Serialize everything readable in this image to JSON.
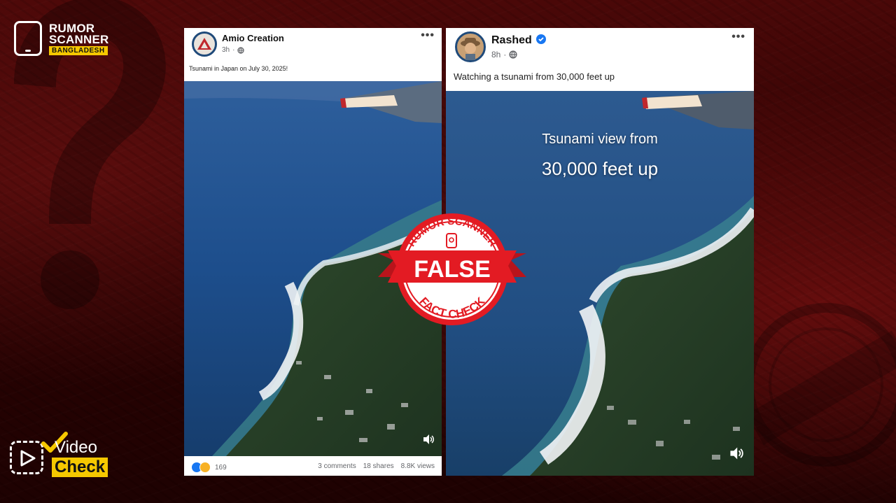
{
  "logo": {
    "line1": "RUMOR",
    "line2": "SCANNER",
    "country": "BANGLADESH",
    "icon": "phone-scan-icon"
  },
  "video_check": {
    "video": "Video",
    "check": "Check",
    "icon": "play-icon"
  },
  "post_left": {
    "author": "Amio Creation",
    "time": "3h",
    "caption": "Tsunami in Japan on July 30, 2025!",
    "reaction_count": "169",
    "comments": "3 comments",
    "shares": "18 shares",
    "views": "8.8K views"
  },
  "post_right": {
    "author": "Rashed",
    "time": "8h",
    "caption": "Watching a tsunami from 30,000 feet up",
    "overlay_line1": "Tsunami view from",
    "overlay_line2": "30,000 feet up"
  },
  "stamp": {
    "top": "RUMOR SCANNER",
    "verdict": "FALSE",
    "bottom": "FACT CHECK"
  },
  "colors": {
    "brand_red": "#e31b23",
    "brand_yellow": "#f5c800",
    "background": "#3a0505"
  }
}
